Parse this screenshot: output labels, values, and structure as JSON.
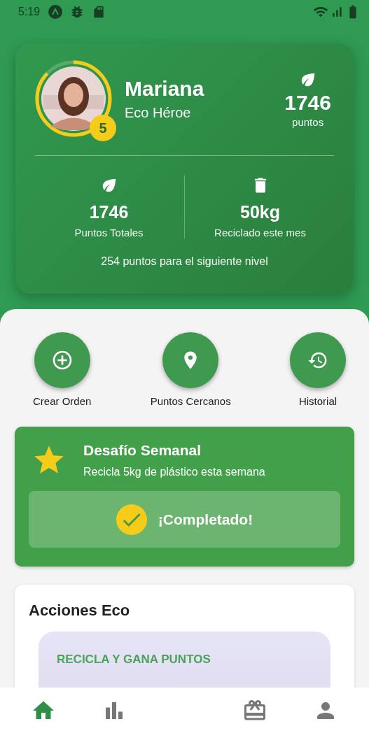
{
  "status_bar": {
    "time": "5:19"
  },
  "profile": {
    "name": "Mariana",
    "rank": "Eco Héroe",
    "level_badge": "5",
    "level": 0.87,
    "points": "1746",
    "points_label": "puntos"
  },
  "stats": [
    {
      "kind": "leaf",
      "value": "1746",
      "label": "Puntos Totales"
    },
    {
      "kind": "trash",
      "value": "50kg",
      "label": "Reciclado este mes"
    }
  ],
  "next_level": "254 puntos para el siguiente nivel",
  "actions": [
    {
      "kind": "add",
      "label": "Crear Orden"
    },
    {
      "kind": "pin",
      "label": "Puntos Cercanos"
    },
    {
      "kind": "history",
      "label": "Historial"
    }
  ],
  "challenge": {
    "title": "Desafío Semanal",
    "description": "Recicla 5kg de plástico esta semana",
    "status": "¡Completado!",
    "completed": true
  },
  "eco_actions": {
    "title": "Acciones Eco",
    "cards": [
      {
        "heading": "RECICLA Y GANA PUNTOS"
      }
    ]
  },
  "nav": [
    {
      "kind": "home",
      "selected": true
    },
    {
      "kind": "chart",
      "selected": false
    },
    {
      "kind": "gift",
      "selected": false
    },
    {
      "kind": "person",
      "selected": false
    }
  ]
}
